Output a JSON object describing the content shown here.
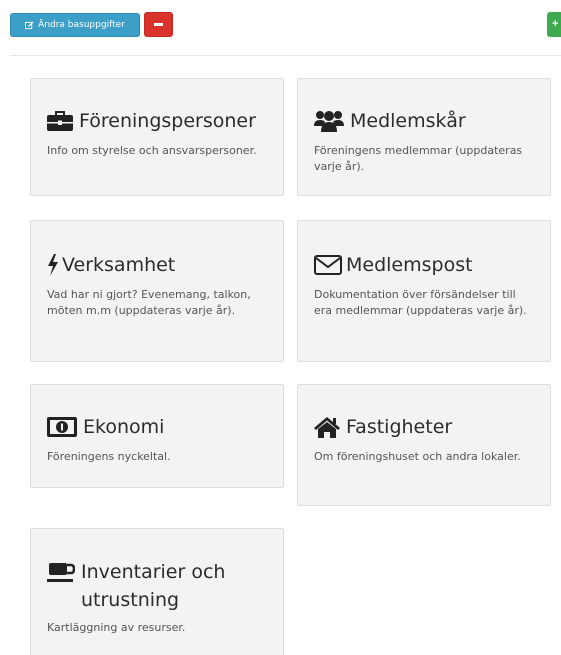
{
  "toolbar": {
    "edit_label": "Ändra basuppgifter",
    "add_label": "+",
    "colors": {
      "edit": "#3c9fc8",
      "remove": "#d9342b",
      "add": "#3daa4f"
    }
  },
  "cards": [
    {
      "icon": "briefcase-icon",
      "title": "Föreningspersoner",
      "description": "Info om styrelse och ansvarspersoner."
    },
    {
      "icon": "users-icon",
      "title": "Medlemskår",
      "description": "Föreningens medlemmar (uppdateras varje år)."
    },
    {
      "icon": "bolt-icon",
      "title": "Verksamhet",
      "description": "Vad har ni gjort? Evenemang, talkon, möten m.m (uppdateras varje år)."
    },
    {
      "icon": "envelope-icon",
      "title": "Medlemspost",
      "description": "Dokumentation över försändelser till era medlemmar (uppdateras varje år)."
    },
    {
      "icon": "money-icon",
      "title": "Ekonomi",
      "description": "Föreningens nyckeltal."
    },
    {
      "icon": "home-icon",
      "title": "Fastigheter",
      "description": "Om föreningshuset och andra lokaler."
    },
    {
      "icon": "coffee-icon",
      "title": "Inventarier och utrustning",
      "description": "Kartläggning av resurser."
    }
  ]
}
